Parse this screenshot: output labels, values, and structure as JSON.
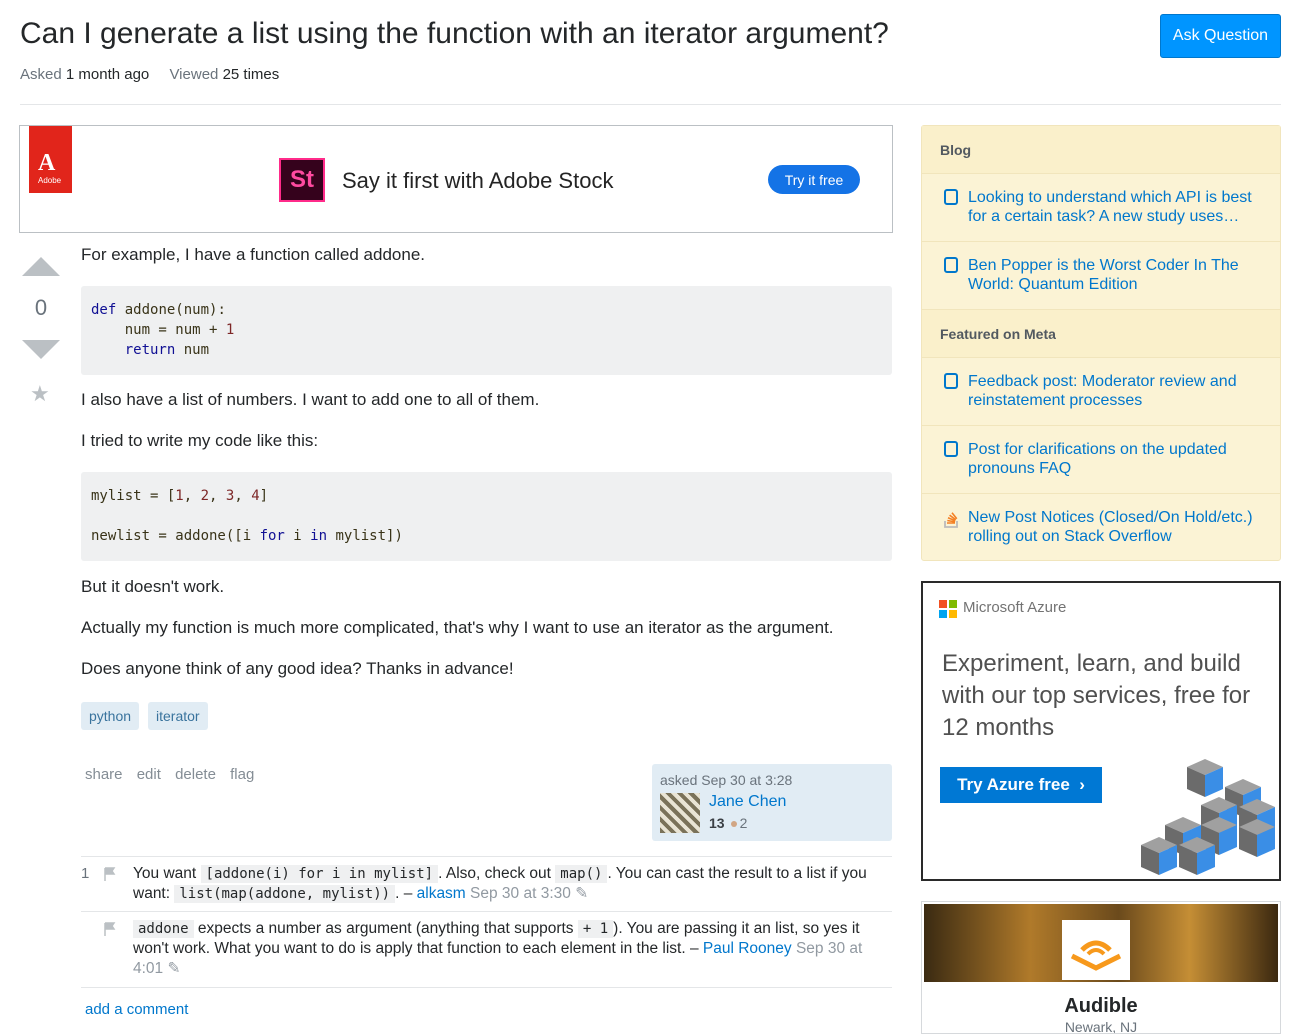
{
  "question": {
    "title": "Can I generate a list using the function with an iterator argument?",
    "asked_label": "Asked",
    "asked_value": "1 month ago",
    "viewed_label": "Viewed",
    "viewed_value": "25 times",
    "ask_button": "Ask Question",
    "votes": "0"
  },
  "ad_top": {
    "brand_logo_text": "Adobe",
    "product_badge": "St",
    "headline": "Say it first with Adobe Stock",
    "cta": "Try it free"
  },
  "post": {
    "p1": "For example, I have a function called addone.",
    "code1_l1_kw": "def",
    "code1_l1_rest": " addone(num):",
    "code1_l2": "    num = num + ",
    "code1_l2_num": "1",
    "code1_l3_kw": "return",
    "code1_l3_rest": " num",
    "p2": "I also have a list of numbers. I want to add one to all of them.",
    "p3": "I tried to write my code like this:",
    "code2_l1_a": "mylist = [",
    "code2_n1": "1",
    "code2_n2": "2",
    "code2_n3": "3",
    "code2_n4": "4",
    "code2_l2_a": "newlist = addone([i ",
    "code2_for": "for",
    "code2_l2_b": " i ",
    "code2_in": "in",
    "code2_l2_c": " mylist])",
    "p4": "But it doesn't work.",
    "p5": "Actually my function is much more complicated, that's why I want to use an iterator as the argument.",
    "p6": "Does anyone think of any good idea? Thanks in advance!",
    "tags": [
      "python",
      "iterator"
    ],
    "menu": {
      "share": "share",
      "edit": "edit",
      "delete": "delete",
      "flag": "flag"
    },
    "owner": {
      "asked": "asked Sep 30 at 3:28",
      "name": "Jane Chen",
      "rep": "13",
      "bronze": "2"
    }
  },
  "comments": [
    {
      "score": "1",
      "t1": "You want ",
      "c1": "[addone(i) for i in mylist]",
      "t2": ". Also, check out ",
      "c2": "map()",
      "t3": ". You can cast the result to a list if you want: ",
      "c3": "list(map(addone, mylist))",
      "t4": ". – ",
      "user": "alkasm",
      "date": " Sep 30 at 3:30"
    },
    {
      "c1": "addone",
      "t1": " expects a number as argument (anything that supports ",
      "c2": "+ 1",
      "t2": "). You are passing it an list, so yes it won't work. What you want to do is apply that function to each element in the list. – ",
      "user": "Paul Rooney",
      "date": " Sep 30 at 4:01"
    }
  ],
  "add_comment": "add a comment",
  "sidebar": {
    "blog_head": "Blog",
    "blog_items": [
      "Looking to understand which API is best for a certain task? A new study uses…",
      "Ben Popper is the Worst Coder In The World: Quantum Edition"
    ],
    "meta_head": "Featured on Meta",
    "meta_items": [
      "Feedback post: Moderator review and reinstatement processes",
      "Post for clarifications on the updated pronouns FAQ",
      "New Post Notices (Closed/On Hold/etc.) rolling out on Stack Overflow"
    ]
  },
  "azure_ad": {
    "brand": "Microsoft Azure",
    "headline": "Experiment, learn, and build with our top services, free for 12 months",
    "cta": "Try Azure free",
    "cta_arrow": "›"
  },
  "audible_ad": {
    "name": "Audible",
    "location": "Newark, NJ"
  },
  "colors": {
    "link": "#0077cc",
    "ask_button": "#0095ff",
    "blog_bg": "#fbf3d5"
  }
}
